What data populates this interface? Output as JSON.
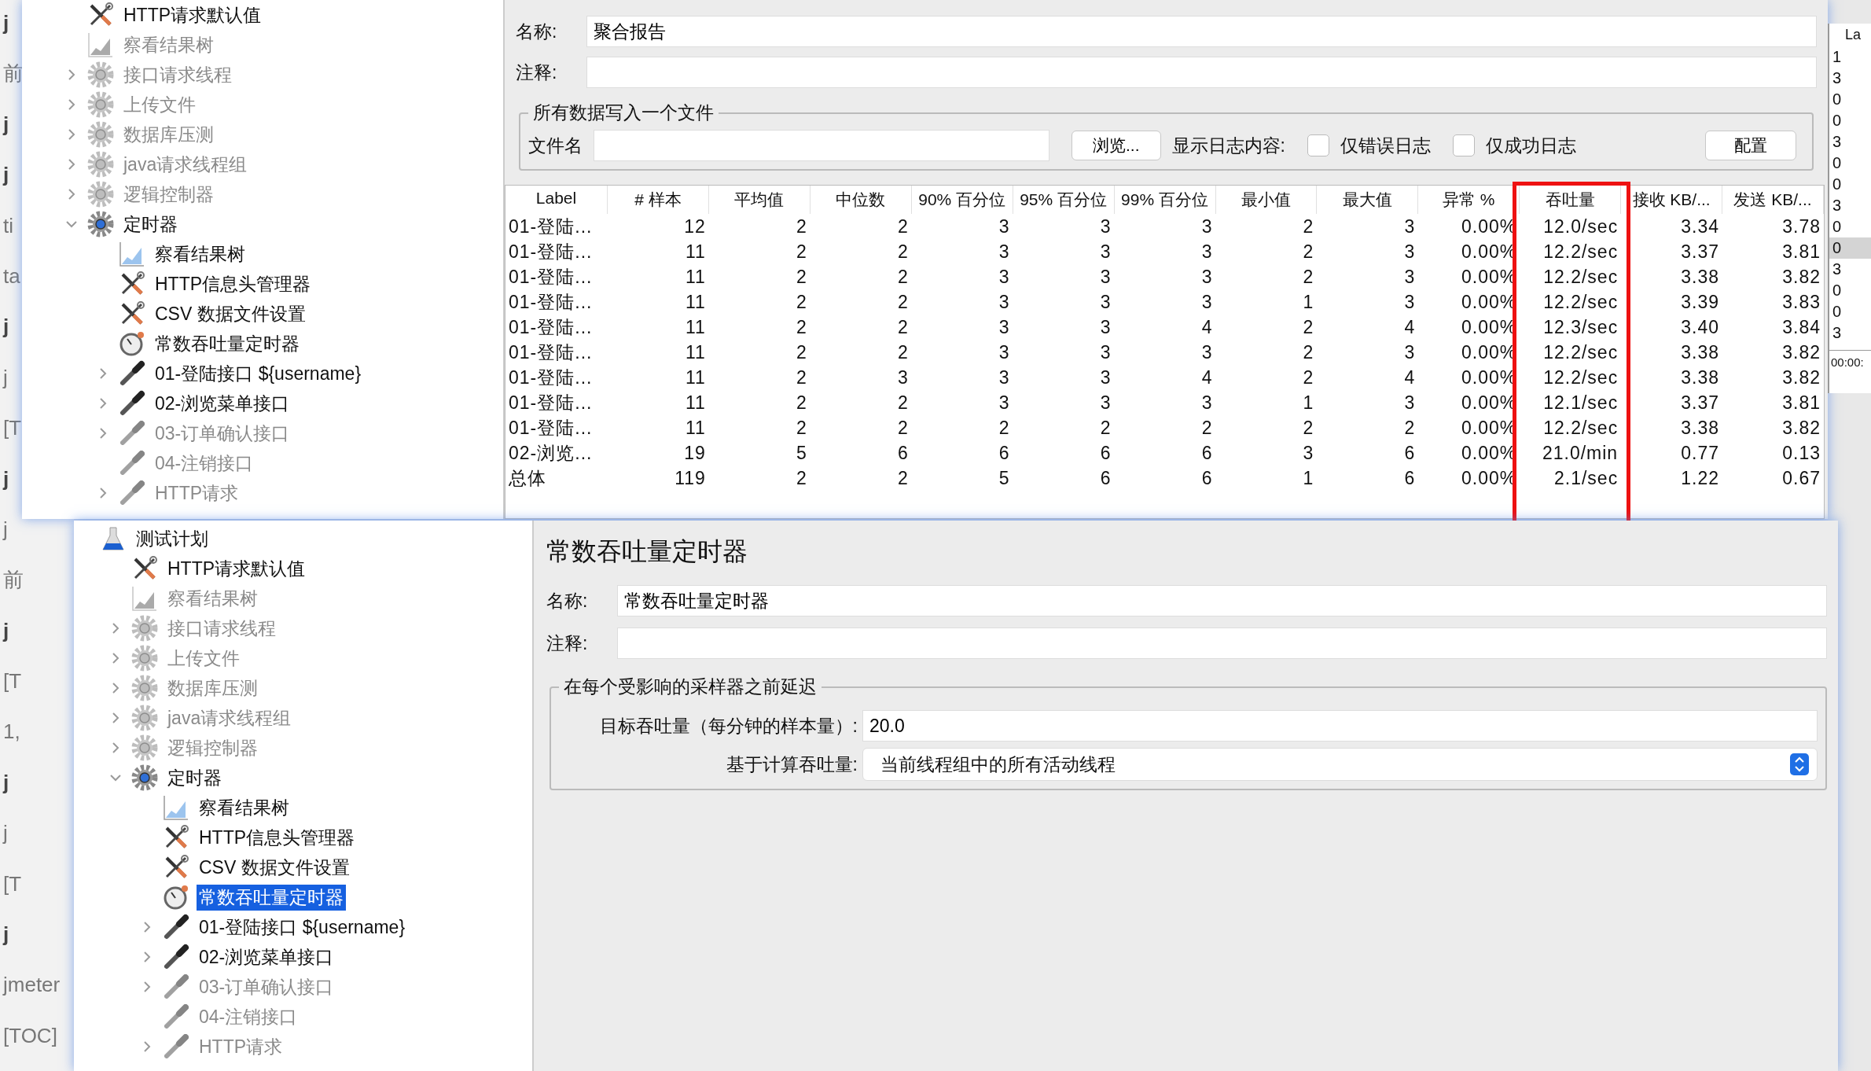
{
  "background_fragments": [
    {
      "text": "j",
      "kind": "bold"
    },
    {
      "text": "前",
      "kind": "plain"
    },
    {
      "text": "j",
      "kind": "bold"
    },
    {
      "text": "j",
      "kind": "bold"
    },
    {
      "text": "ti",
      "kind": "plain"
    },
    {
      "text": "ta",
      "kind": "plain"
    },
    {
      "text": "j",
      "kind": "bold"
    },
    {
      "text": "j",
      "kind": "plain"
    },
    {
      "text": "[T",
      "kind": "plain"
    },
    {
      "text": "j",
      "kind": "bold"
    },
    {
      "text": "j",
      "kind": "plain"
    },
    {
      "text": "前",
      "kind": "plain"
    },
    {
      "text": "j",
      "kind": "bold"
    },
    {
      "text": "[T",
      "kind": "plain"
    },
    {
      "text": "1,",
      "kind": "plain"
    },
    {
      "text": "j",
      "kind": "bold"
    },
    {
      "text": "j",
      "kind": "plain"
    },
    {
      "text": "[T",
      "kind": "plain"
    },
    {
      "text": "j",
      "kind": "bold"
    },
    {
      "text": "jmeter",
      "kind": "plain"
    },
    {
      "text": "[TOC]",
      "kind": "plain"
    }
  ],
  "top_window": {
    "tree": [
      {
        "label": "HTTP请求默认值",
        "kind": "config",
        "disabled": false,
        "selected": false
      },
      {
        "label": "察看结果树",
        "kind": "listener",
        "disabled": true,
        "selected": false
      },
      {
        "label": "接口请求线程",
        "kind": "gear",
        "disabled": true,
        "expanded": false,
        "selected": false
      },
      {
        "label": "上传文件",
        "kind": "gear",
        "disabled": true,
        "expanded": false,
        "selected": false
      },
      {
        "label": "数据库压测",
        "kind": "gear",
        "disabled": true,
        "expanded": false,
        "selected": false
      },
      {
        "label": "java请求线程组",
        "kind": "gear",
        "disabled": true,
        "expanded": false,
        "selected": false
      },
      {
        "label": "逻辑控制器",
        "kind": "gear",
        "disabled": true,
        "expanded": false,
        "selected": false
      },
      {
        "label": "定时器",
        "kind": "gear",
        "disabled": false,
        "expanded": true,
        "selected": false,
        "children": [
          {
            "label": "察看结果树",
            "kind": "listener",
            "disabled": false,
            "selected": false
          },
          {
            "label": "HTTP信息头管理器",
            "kind": "config",
            "disabled": false,
            "selected": false
          },
          {
            "label": "CSV 数据文件设置",
            "kind": "config",
            "disabled": false,
            "selected": false
          },
          {
            "label": "常数吞吐量定时器",
            "kind": "timer",
            "disabled": false,
            "selected": false
          },
          {
            "label": "01-登陆接口 ${username}",
            "kind": "sampler",
            "disabled": false,
            "expanded": false,
            "selected": false
          },
          {
            "label": "02-浏览菜单接口",
            "kind": "sampler",
            "disabled": false,
            "expanded": false,
            "selected": false
          },
          {
            "label": "03-订单确认接口",
            "kind": "sampler",
            "disabled": true,
            "expanded": false,
            "selected": false
          },
          {
            "label": "04-注销接口",
            "kind": "sampler",
            "disabled": true,
            "selected": false
          },
          {
            "label": "HTTP请求",
            "kind": "sampler",
            "disabled": true,
            "expanded": false,
            "selected": false
          }
        ]
      }
    ],
    "name_label": "名称:",
    "name_value": "聚合报告",
    "comment_label": "注释:",
    "file_group": {
      "title": "所有数据写入一个文件",
      "file_label": "文件名",
      "browse_button": "浏览...",
      "log_label": "显示日志内容:",
      "checkboxes": [
        {
          "label": "仅错误日志",
          "checked": false
        },
        {
          "label": "仅成功日志",
          "checked": false
        }
      ],
      "config_button": "配置"
    },
    "table": {
      "columns": [
        "Label",
        "# 样本",
        "平均值",
        "中位数",
        "90% 百分位",
        "95% 百分位",
        "99% 百分位",
        "最小值",
        "最大值",
        "异常 %",
        "吞吐量",
        "接收 KB/...",
        "发送 KB/..."
      ],
      "rows": [
        [
          "01-登陆...",
          "12",
          "2",
          "2",
          "3",
          "3",
          "3",
          "2",
          "3",
          "0.00%",
          "12.0/sec",
          "3.34",
          "3.78"
        ],
        [
          "01-登陆...",
          "11",
          "2",
          "2",
          "3",
          "3",
          "3",
          "2",
          "3",
          "0.00%",
          "12.2/sec",
          "3.37",
          "3.81"
        ],
        [
          "01-登陆...",
          "11",
          "2",
          "2",
          "3",
          "3",
          "3",
          "2",
          "3",
          "0.00%",
          "12.2/sec",
          "3.38",
          "3.82"
        ],
        [
          "01-登陆...",
          "11",
          "2",
          "2",
          "3",
          "3",
          "3",
          "1",
          "3",
          "0.00%",
          "12.2/sec",
          "3.39",
          "3.83"
        ],
        [
          "01-登陆...",
          "11",
          "2",
          "2",
          "3",
          "3",
          "4",
          "2",
          "4",
          "0.00%",
          "12.3/sec",
          "3.40",
          "3.84"
        ],
        [
          "01-登陆...",
          "11",
          "2",
          "2",
          "3",
          "3",
          "3",
          "2",
          "3",
          "0.00%",
          "12.2/sec",
          "3.38",
          "3.82"
        ],
        [
          "01-登陆...",
          "11",
          "2",
          "3",
          "3",
          "3",
          "4",
          "2",
          "4",
          "0.00%",
          "12.2/sec",
          "3.38",
          "3.82"
        ],
        [
          "01-登陆...",
          "11",
          "2",
          "2",
          "3",
          "3",
          "3",
          "1",
          "3",
          "0.00%",
          "12.1/sec",
          "3.37",
          "3.81"
        ],
        [
          "01-登陆...",
          "11",
          "2",
          "2",
          "2",
          "2",
          "2",
          "2",
          "2",
          "0.00%",
          "12.2/sec",
          "3.38",
          "3.82"
        ],
        [
          "02-浏览...",
          "19",
          "5",
          "6",
          "6",
          "6",
          "6",
          "3",
          "6",
          "0.00%",
          "21.0/min",
          "0.77",
          "0.13"
        ],
        [
          "总体",
          "119",
          "2",
          "2",
          "5",
          "6",
          "6",
          "1",
          "6",
          "0.00%",
          "2.1/sec",
          "1.22",
          "0.67"
        ]
      ]
    }
  },
  "right_window": {
    "header": "La",
    "rows": [
      {
        "text": "1",
        "selected": false
      },
      {
        "text": "3",
        "selected": false
      },
      {
        "text": "0",
        "selected": false
      },
      {
        "text": "0",
        "selected": false
      },
      {
        "text": "3",
        "selected": false
      },
      {
        "text": "0",
        "selected": false
      },
      {
        "text": "0",
        "selected": false
      },
      {
        "text": "3",
        "selected": false
      },
      {
        "text": "0",
        "selected": false
      },
      {
        "text": "0",
        "selected": true
      },
      {
        "text": "3",
        "selected": false
      },
      {
        "text": "0",
        "selected": false
      },
      {
        "text": "0",
        "selected": false
      },
      {
        "text": "3",
        "selected": false
      }
    ],
    "time": "00:00:"
  },
  "bottom_window": {
    "tree": [
      {
        "label": "测试计划",
        "kind": "testplan",
        "disabled": false,
        "selected": false,
        "children": [
          {
            "label": "HTTP请求默认值",
            "kind": "config",
            "disabled": false,
            "selected": false
          },
          {
            "label": "察看结果树",
            "kind": "listener",
            "disabled": true,
            "selected": false
          },
          {
            "label": "接口请求线程",
            "kind": "gear",
            "disabled": true,
            "expanded": false,
            "selected": false
          },
          {
            "label": "上传文件",
            "kind": "gear",
            "disabled": true,
            "expanded": false,
            "selected": false
          },
          {
            "label": "数据库压测",
            "kind": "gear",
            "disabled": true,
            "expanded": false,
            "selected": false
          },
          {
            "label": "java请求线程组",
            "kind": "gear",
            "disabled": true,
            "expanded": false,
            "selected": false
          },
          {
            "label": "逻辑控制器",
            "kind": "gear",
            "disabled": true,
            "expanded": false,
            "selected": false
          },
          {
            "label": "定时器",
            "kind": "gear",
            "disabled": false,
            "expanded": true,
            "selected": false,
            "children": [
              {
                "label": "察看结果树",
                "kind": "listener",
                "disabled": false,
                "selected": false
              },
              {
                "label": "HTTP信息头管理器",
                "kind": "config",
                "disabled": false,
                "selected": false
              },
              {
                "label": "CSV 数据文件设置",
                "kind": "config",
                "disabled": false,
                "selected": false
              },
              {
                "label": "常数吞吐量定时器",
                "kind": "timer",
                "disabled": false,
                "selected": true
              },
              {
                "label": "01-登陆接口 ${username}",
                "kind": "sampler",
                "disabled": false,
                "expanded": false,
                "selected": false
              },
              {
                "label": "02-浏览菜单接口",
                "kind": "sampler",
                "disabled": false,
                "expanded": false,
                "selected": false
              },
              {
                "label": "03-订单确认接口",
                "kind": "sampler",
                "disabled": true,
                "expanded": false,
                "selected": false
              },
              {
                "label": "04-注销接口",
                "kind": "sampler",
                "disabled": true,
                "selected": false
              },
              {
                "label": "HTTP请求",
                "kind": "sampler",
                "disabled": true,
                "expanded": false,
                "selected": false
              }
            ]
          }
        ]
      }
    ],
    "title": "常数吞吐量定时器",
    "name_label": "名称:",
    "name_value": "常数吞吐量定时器",
    "comment_label": "注释:",
    "delay_group": {
      "title": "在每个受影响的采样器之前延迟",
      "target_label": "目标吞吐量（每分钟的样本量）:",
      "target_value": "20.0",
      "basis_label": "基于计算吞吐量:",
      "basis_value": "当前线程组中的所有活动线程"
    }
  }
}
